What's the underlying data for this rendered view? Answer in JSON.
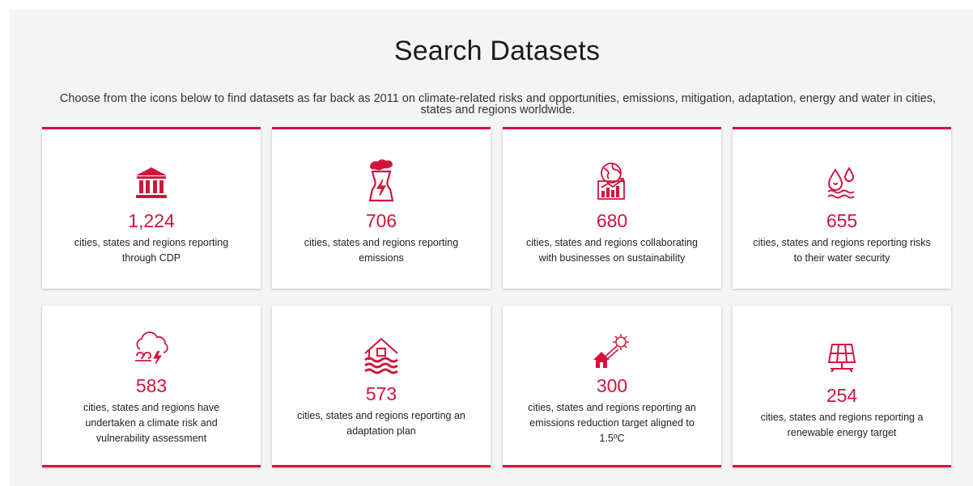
{
  "header": {
    "title": "Search Datasets",
    "subtitle": "Choose from the icons below to find datasets as far back as 2011 on climate-related risks and opportunities, emissions, mitigation, adaptation, energy and water in cities, states and regions worldwide."
  },
  "accent_color": "#d0153d",
  "cards": [
    {
      "icon": "government-building-icon",
      "count": "1,224",
      "description": "cities, states and regions reporting through CDP"
    },
    {
      "icon": "power-plant-emissions-icon",
      "count": "706",
      "description": "cities, states and regions reporting emissions"
    },
    {
      "icon": "globe-chart-icon",
      "count": "680",
      "description": "cities, states and regions collaborating with businesses on sustainability"
    },
    {
      "icon": "water-drops-icon",
      "count": "655",
      "description": "cities, states and regions reporting risks to their water security"
    },
    {
      "icon": "storm-cloud-icon",
      "count": "583",
      "description": "cities, states and regions have undertaken a climate risk and vulnerability assessment"
    },
    {
      "icon": "flooded-house-icon",
      "count": "573",
      "description": "cities, states and regions reporting an adaptation plan"
    },
    {
      "icon": "sun-house-icon",
      "count": "300",
      "description": "cities, states and regions reporting an emissions reduction target aligned to 1.5ºC"
    },
    {
      "icon": "solar-panel-icon",
      "count": "254",
      "description": "cities, states and regions reporting a renewable energy target"
    }
  ]
}
